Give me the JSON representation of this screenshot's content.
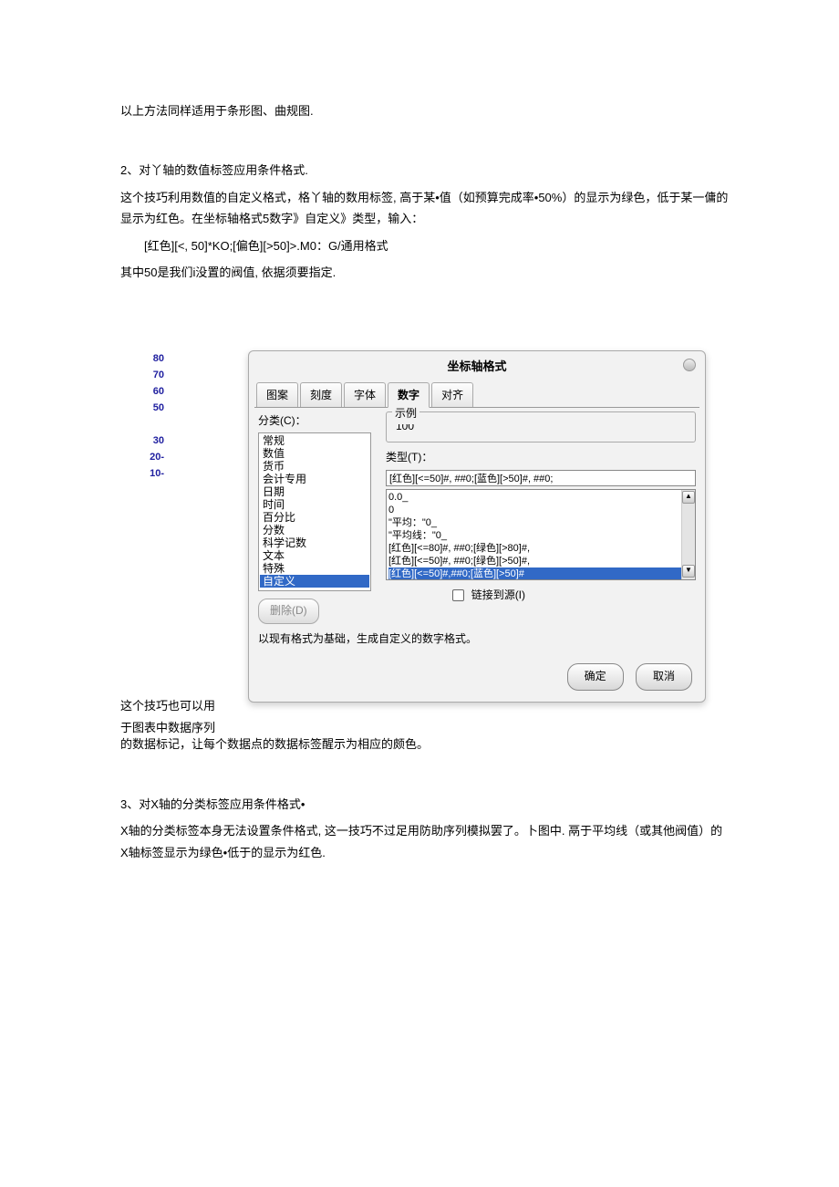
{
  "top": {
    "p1": "以上方法同样适用于条形图、曲规图."
  },
  "sec2": {
    "title": "2、对丫轴的数值标签应用条件格式.",
    "p1": "这个技巧利用数值的自定义格式，格丫轴的数用标签, 高于某•值（如预算完成率•50%）的显示为绿色，低于某一傭的显示为红色。在坐标轴格式5数字》自定义》类型，输入：",
    "code": "[红色][<, 50]*KO;[偏色][>50]>.M0：G/通用格式",
    "p2": "其中50是我们i没置的阀值, 依据须要指定."
  },
  "yaxis": [
    "80",
    "70",
    "60",
    "50",
    "",
    "30",
    "20-",
    "10-"
  ],
  "dialog": {
    "title": "坐标轴格式",
    "tabs": [
      "图案",
      "刻度",
      "字体",
      "数字",
      "对齐"
    ],
    "active_tab": 3,
    "cat_label": "分类(C)：",
    "categories": [
      "常规",
      "数值",
      "货币",
      "会计专用",
      "日期",
      "时间",
      "百分比",
      "分数",
      "科学记数",
      "文本",
      "特殊",
      "自定义"
    ],
    "sel_cat": 11,
    "delete_btn": "删除(D)",
    "example_label": "示例",
    "example_val": "100",
    "type_label": "类型(T)：",
    "type_input": "[红色][<=50]#, ##0;[蓝色][>50]#, ##0;",
    "type_list": [
      "0.0_",
      "0",
      "\"平均：\"0_",
      "\"平均线：\"0_",
      "[红色][<=80]#, ##0;[绿色][>80]#,",
      "[红色][<=50]#, ##0;[绿色][>50]#,",
      "[红色][<=50]#,##0;[蓝色][>50]#"
    ],
    "sel_type": 6,
    "link_label": "链接到源(I)",
    "hint": "以现有格式为基础，生成自定义的数字格式。",
    "ok": "确定",
    "cancel": "取消"
  },
  "below": {
    "p1a": "这个技巧也可以用",
    "p1b": "于图表中数据序列",
    "p2": "的数据标记，让每个数据点的数据标签醒示为相应的颇色。"
  },
  "sec3": {
    "title": "3、对X轴的分类标签应用条件格式•",
    "p1": "X轴的分类标签本身无法设置条件格式, 这一技巧不过足用防助序列模拟罢了。卜图中. 鬲于平均线（或其他阀值）的X轴标签显示为绿色•低于的显示为红色."
  }
}
